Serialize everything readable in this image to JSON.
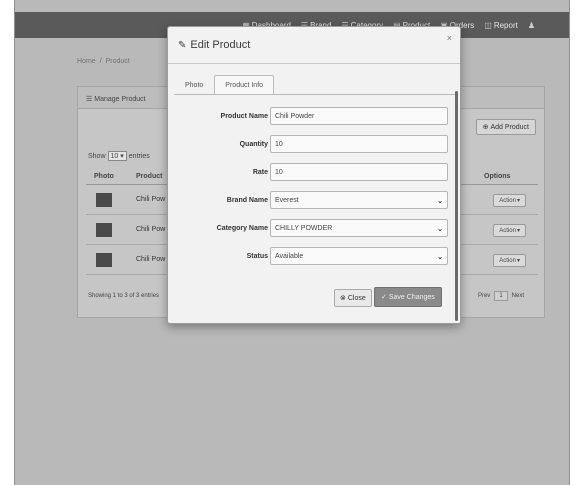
{
  "navbar": {
    "items": [
      {
        "icon": "dashboard-icon",
        "label": "Dashboard"
      },
      {
        "icon": "brand-icon",
        "label": "Brand"
      },
      {
        "icon": "category-icon",
        "label": "Category"
      },
      {
        "icon": "product-icon",
        "label": "Product"
      },
      {
        "icon": "orders-icon",
        "label": "Orders"
      },
      {
        "icon": "report-icon",
        "label": "Report"
      }
    ]
  },
  "breadcrumb": {
    "home": "Home",
    "current": "Product"
  },
  "panel": {
    "heading": "Manage Product",
    "add_button": "Add Product",
    "show_label": "Show",
    "entries_value": "10",
    "entries_label": "entries",
    "columns": [
      "Photo",
      "Product",
      "Options"
    ],
    "rows": [
      {
        "name": "Chili Pow",
        "action": "Action"
      },
      {
        "name": "Chili Pow",
        "action": "Action"
      },
      {
        "name": "Chili Pow",
        "action": "Action"
      }
    ],
    "showing_text": "Showing 1 to 3 of 3 entries",
    "pager": {
      "prev": "Prev",
      "page": "1",
      "next": "Next"
    }
  },
  "modal": {
    "title": "Edit Product",
    "close_symbol": "×",
    "tabs": [
      {
        "label": "Photo",
        "active": false
      },
      {
        "label": "Product Info",
        "active": true
      }
    ],
    "fields": [
      {
        "label": "Product Name",
        "value": "Chili Powder",
        "type": "input"
      },
      {
        "label": "Quantity",
        "value": "10",
        "type": "input"
      },
      {
        "label": "Rate",
        "value": "10",
        "type": "input"
      },
      {
        "label": "Brand Name",
        "value": "Everest",
        "type": "select"
      },
      {
        "label": "Category Name",
        "value": "CHILLY POWDER",
        "type": "select"
      },
      {
        "label": "Status",
        "value": "Available",
        "type": "select"
      }
    ],
    "close_button": "Close",
    "save_button": "Save Changes"
  },
  "colors": {
    "overlay": "#b9b9b9",
    "modal_bg": "#f2f2f2",
    "save_button": "#8a8a8a"
  }
}
